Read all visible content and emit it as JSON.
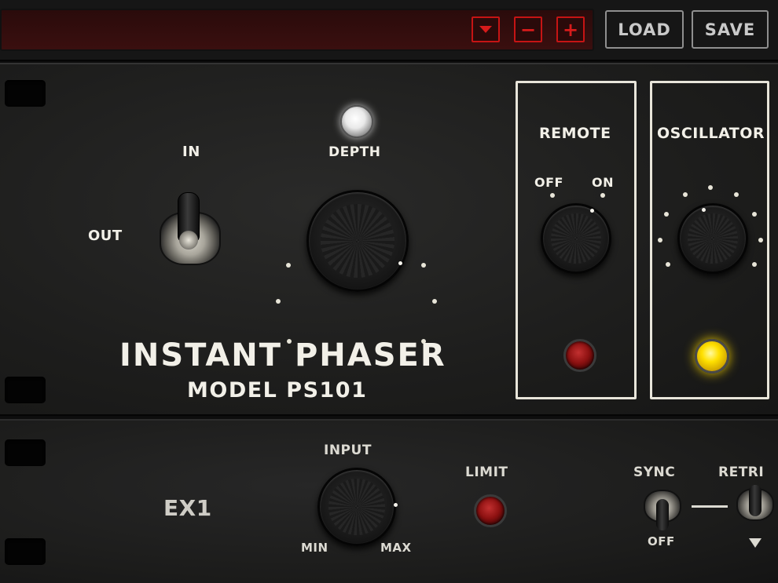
{
  "topbar": {
    "preset_name": "",
    "down_icon": "triangle-down-icon",
    "minus_label": "−",
    "plus_label": "+",
    "load_label": "LOAD",
    "save_label": "SAVE",
    "accent_color": "#c61414"
  },
  "phaser": {
    "switch_in_label": "IN",
    "switch_out_label": "OUT",
    "depth_label": "DEPTH",
    "brand_name": "INSTANT PHASER",
    "model_label": "MODEL PS101",
    "remote": {
      "title": "REMOTE",
      "off_label": "OFF",
      "on_label": "ON",
      "led_color": "#8d1111"
    },
    "oscillator": {
      "title": "OSCILLATOR",
      "led_color": "#ffe000"
    }
  },
  "ex1": {
    "unit_label": "EX1",
    "input_label": "INPUT",
    "min_label": "MIN",
    "max_label": "MAX",
    "limit_label": "LIMIT",
    "sync_label": "SYNC",
    "sync_off_label": "OFF",
    "retrig_label": "RETRI"
  }
}
